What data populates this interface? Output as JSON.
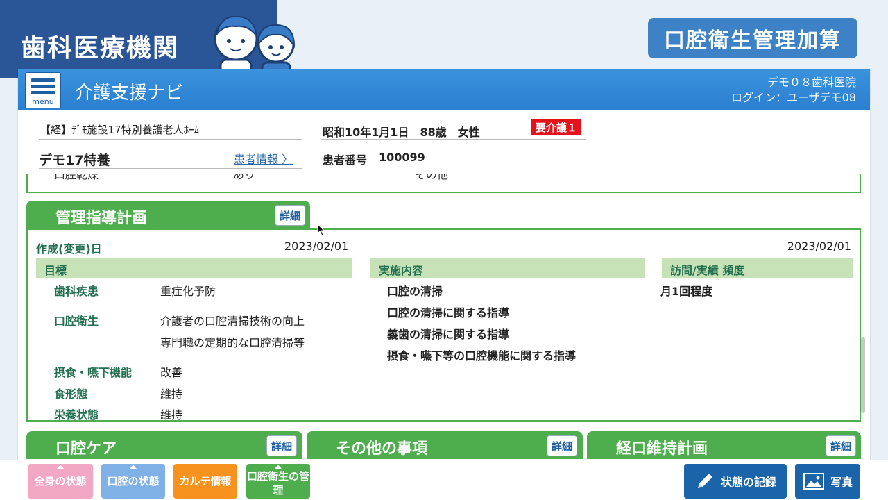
{
  "corner": {
    "title": "歯科医療機関"
  },
  "top_badge": "口腔衛生管理加算",
  "header": {
    "menu_label": "menu",
    "app_title": "介護支援ナビ",
    "clinic": "デモ０８歯科医院",
    "login": "ログイン：ユーザデモ08"
  },
  "patient": {
    "facility": "【経】ﾃﾞﾓ施設17特別養護老人ﾎｰﾑ",
    "name": "デモ17特養",
    "info_link": "患者情報 〉",
    "birth": "昭和10年1月1日　88歳　女性",
    "care_level": "要介護１",
    "patient_no_label": "患者番号",
    "patient_no": "100099"
  },
  "prev_section": {
    "item": "口腔乾燥",
    "value": "あり",
    "other": "その他"
  },
  "plan": {
    "title": "管理指導計画",
    "detail": "詳細",
    "created_label": "作成(変更)日",
    "created_date_left": "2023/02/01",
    "created_date_right": "2023/02/01",
    "col_goal": "目標",
    "col_content": "実施内容",
    "col_visit": "訪問/実績 頻度",
    "goals": [
      {
        "label": "歯科疾患",
        "values": [
          "重症化予防"
        ]
      },
      {
        "label": "口腔衛生",
        "values": [
          "介護者の口腔清掃技術の向上",
          "専門職の定期的な口腔清掃等"
        ]
      },
      {
        "label": "摂食・嚥下機能",
        "values": [
          "改善"
        ]
      },
      {
        "label": "食形態",
        "values": [
          "維持"
        ]
      },
      {
        "label": "栄養状態",
        "values": [
          "維持"
        ]
      }
    ],
    "contents": [
      "口腔の清掃",
      "口腔の清掃に関する指導",
      "義歯の清掃に関する指導",
      "摂食・嚥下等の口腔機能に関する指導"
    ],
    "frequency": "月1回程度"
  },
  "bottom_tabs": [
    {
      "title": "口腔ケア",
      "detail": "詳細"
    },
    {
      "title": "その他の事項",
      "detail": "詳細"
    },
    {
      "title": "経口維持計画",
      "detail": "詳細"
    }
  ],
  "footer": {
    "whole_body": "全身の状態",
    "oral_status": "口腔の状態",
    "chart_info": "カルテ情報",
    "oral_hygiene": "口腔衛生の管理",
    "record": "状態の記録",
    "photo": "写真"
  },
  "colors": {
    "navy": "#2a5597",
    "header_blue": "#2b7fcf",
    "green": "#4eae4e",
    "pink": "#f2a7c3",
    "light_blue": "#7fb0e6",
    "orange": "#f7921e",
    "red": "#e3121c"
  }
}
